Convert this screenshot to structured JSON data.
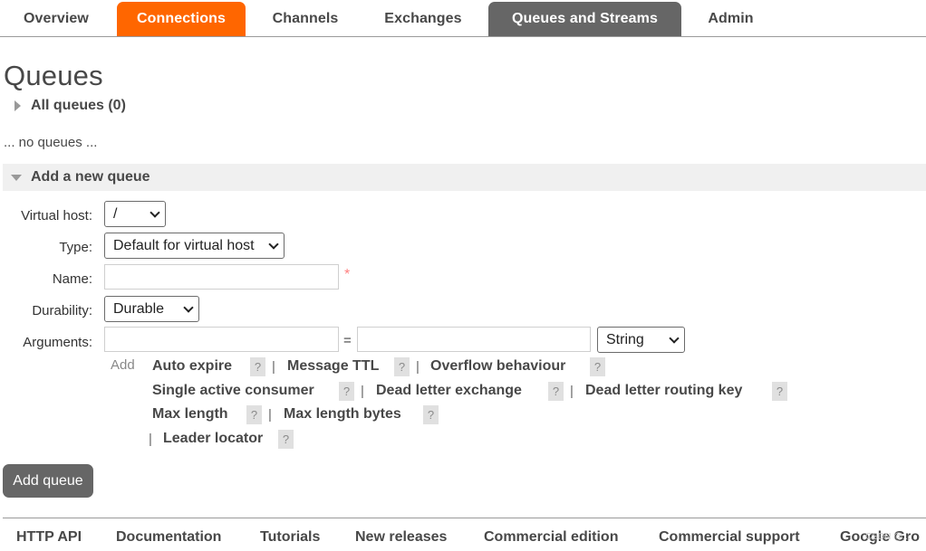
{
  "nav": {
    "tabs": [
      {
        "label": "Overview"
      },
      {
        "label": "Connections"
      },
      {
        "label": "Channels"
      },
      {
        "label": "Exchanges"
      },
      {
        "label": "Queues and Streams"
      },
      {
        "label": "Admin"
      }
    ],
    "active_tab": "Queues and Streams",
    "highlight_tab": "Connections"
  },
  "page": {
    "title": "Queues",
    "all_queues_label": "All queues (0)",
    "no_queues_text": "... no queues ...",
    "add_section_label": "Add a new queue"
  },
  "form": {
    "virtual_host": {
      "label": "Virtual host:",
      "value": "/"
    },
    "type": {
      "label": "Type:",
      "value": "Default for virtual host"
    },
    "name": {
      "label": "Name:",
      "value": "",
      "required_marker": "*"
    },
    "durability": {
      "label": "Durability:",
      "value": "Durable"
    },
    "arguments": {
      "label": "Arguments:",
      "key_value": "",
      "equals": "=",
      "value_value": "",
      "type_value": "String"
    },
    "add_label": "Add",
    "argument_links": [
      {
        "label": "Auto expire"
      },
      {
        "label": "Message TTL"
      },
      {
        "label": "Overflow behaviour"
      },
      {
        "label": "Single active consumer"
      },
      {
        "label": "Dead letter exchange"
      },
      {
        "label": "Dead letter routing key"
      },
      {
        "label": "Max length"
      },
      {
        "label": "Max length bytes"
      },
      {
        "label": "Leader locator"
      }
    ],
    "help_glyph": "?",
    "separator": "|",
    "submit_label": "Add queue"
  },
  "footer": {
    "links": [
      {
        "label": "HTTP API"
      },
      {
        "label": "Documentation"
      },
      {
        "label": "Tutorials"
      },
      {
        "label": "New releases"
      },
      {
        "label": "Commercial edition"
      },
      {
        "label": "Commercial support"
      },
      {
        "label": "Google Gro"
      }
    ],
    "watermark": "CSDN @..."
  },
  "colors": {
    "accent_orange": "#ff6600",
    "tab_grey": "#666666",
    "text": "#484848",
    "required": "#ff8080"
  }
}
